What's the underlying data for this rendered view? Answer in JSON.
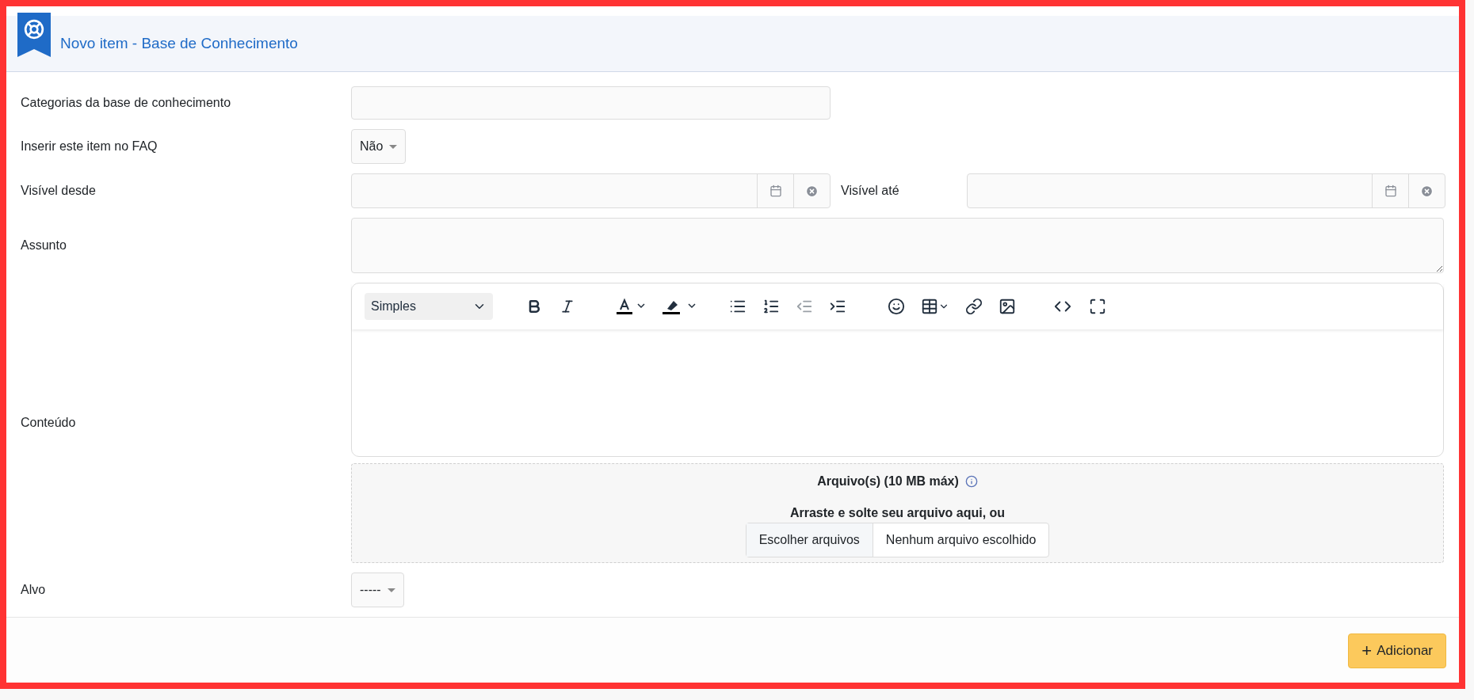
{
  "header": {
    "title": "Novo item - Base de Conhecimento"
  },
  "fields": [
    {
      "kind": "text",
      "label": "Categorias da base de conhecimento"
    },
    {
      "kind": "select",
      "label": "Inserir este item no FAQ",
      "value": "Não"
    },
    {
      "kind": "daterange",
      "label": "Visível desde",
      "second_label": "Visível até"
    },
    {
      "kind": "textarea",
      "label": "Assunto"
    },
    {
      "kind": "editor",
      "label": "Conteúdo",
      "format": "Simples",
      "dropzone_title": "Arquivo(s) (10 MB máx)",
      "dropzone_hint": "Arraste e solte seu arquivo aqui, ou",
      "choose_button": "Escolher arquivos",
      "file_status": "Nenhum arquivo escolhido"
    },
    {
      "kind": "select",
      "label": "Alvo",
      "value": "-----"
    }
  ],
  "submit_button": {
    "icon": "+",
    "label": "Adicionar"
  }
}
